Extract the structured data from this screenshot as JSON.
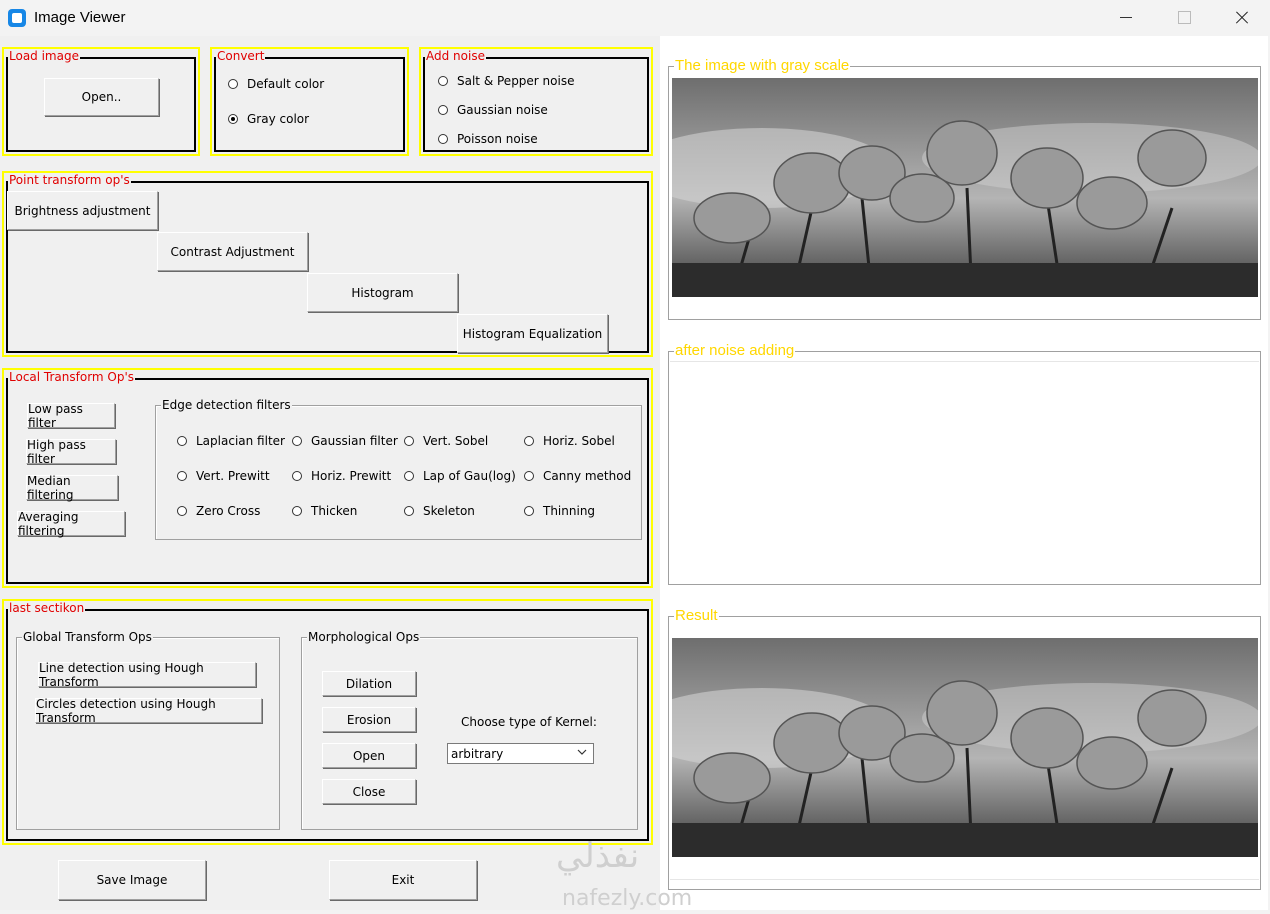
{
  "window": {
    "title": "Image Viewer"
  },
  "load_image": {
    "title": "Load image",
    "open_label": "Open.."
  },
  "convert": {
    "title": "Convert",
    "options": [
      "Default color",
      "Gray color"
    ],
    "selected": "Gray color"
  },
  "add_noise": {
    "title": "Add noise",
    "options": [
      "Salt & Pepper noise",
      "Gaussian noise",
      "Poisson noise"
    ]
  },
  "point_transform": {
    "title": "Point transform op's",
    "buttons": [
      "Brightness adjustment",
      "Contrast Adjustment",
      "Histogram",
      "Histogram Equalization"
    ]
  },
  "local_transform": {
    "title": "Local Transform Op's",
    "buttons": [
      "Low pass filter",
      "High pass filter",
      "Median filtering",
      "Averaging filtering"
    ],
    "edge": {
      "title": "Edge detection filters",
      "options": [
        "Laplacian filter",
        "Gaussian filter",
        "Vert. Sobel",
        "Horiz. Sobel",
        "Vert. Prewitt",
        "Horiz. Prewitt",
        "Lap of Gau(log)",
        "Canny method",
        "Zero Cross",
        "Thicken",
        "Skeleton",
        "Thinning"
      ]
    }
  },
  "last_section": {
    "title": "last sectikon",
    "global": {
      "title": "Global Transform Ops",
      "buttons": [
        "Line detection using Hough Transform",
        "Circles detection using Hough Transform"
      ]
    },
    "morph": {
      "title": "Morphological Ops",
      "buttons": [
        "Dilation",
        "Erosion",
        "Open",
        "Close"
      ],
      "kernel_label": "Choose type of Kernel:",
      "kernel_value": "arbitrary"
    }
  },
  "bottom": {
    "save_label": "Save Image",
    "exit_label": "Exit"
  },
  "right": {
    "gray_title": "The image with gray scale",
    "noise_title": "after noise adding",
    "result_title": "Result"
  },
  "watermark": {
    "arabic": "نفذلي",
    "latin": "nafezly.com"
  },
  "colors": {
    "frame_highlight": "#ffff00",
    "section_title": "#e00000",
    "pane_title": "#ffd700"
  }
}
